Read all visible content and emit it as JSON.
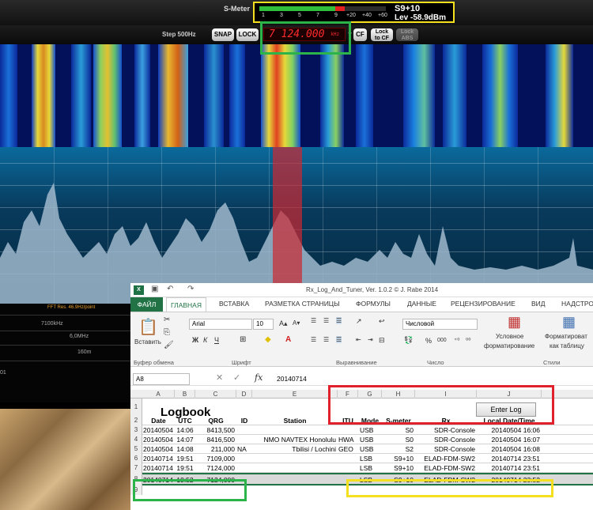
{
  "smeter": {
    "label": "S-Meter",
    "scale": [
      "1",
      "3",
      "5",
      "7",
      "9",
      "+20",
      "+40",
      "+60"
    ],
    "reading": "S9+10",
    "level": "Lev -58.9dBm"
  },
  "sdr_controls": {
    "step": "Step 500Hz",
    "snap": "SNAP",
    "lock": "LOCK",
    "frequency": "7 124.000",
    "freq_unit": "kHz",
    "cf": "CF",
    "lock_to_cf_1": "Lock",
    "lock_to_cf_2": "to CF",
    "lock_abs_1": "Lock",
    "lock_abs_2": "ABS",
    "plus_minus": "+"
  },
  "lower_panel": {
    "fft_res": "FFT Res. 46.9Hz/point",
    "freq1": "7100kHz",
    "freq2": "6,0MHz",
    "len": "160m",
    "side": "01"
  },
  "excel": {
    "title": "Rx_Log_And_Tuner, Ver. 1.0.2 © J. Rabe 2014",
    "file_tab": "ФАЙЛ",
    "tabs": [
      "ГЛАВНАЯ",
      "ВСТАВКА",
      "РАЗМЕТКА СТРАНИЦЫ",
      "ФОРМУЛЫ",
      "ДАННЫЕ",
      "РЕЦЕНЗИРОВАНИЕ",
      "ВИД",
      "НАДСТРОЙ"
    ],
    "ribbon": {
      "paste": "Вставить",
      "font_name": "Arial",
      "font_size": "10",
      "bold": "Ж",
      "italic": "К",
      "underline": "Ч",
      "number_format": "Числовой",
      "percent": "%",
      "thousands": "000",
      "conditional_1": "Условное",
      "conditional_2": "форматирование",
      "table_1": "Форматироват",
      "table_2": "как таблицу",
      "groups": [
        "Буфер обмена",
        "Шрифт",
        "Выравнивание",
        "Число",
        "Стили"
      ]
    },
    "name_box": "A8",
    "formula": "20140714",
    "columns": [
      "A",
      "B",
      "C",
      "D",
      "E",
      "F",
      "G",
      "H",
      "I",
      "J"
    ],
    "row_numbers": [
      "1",
      "2",
      "3",
      "4",
      "5",
      "6",
      "7",
      "8",
      "9"
    ],
    "sheet_title": "Logbook",
    "enter_log": "Enter Log",
    "headers": [
      "Date",
      "UTC",
      "QRG",
      "ID",
      "Station",
      "ITU",
      "Mode",
      "S-meter",
      "Rx",
      "Local Date/Time"
    ],
    "rows": [
      [
        "20140504",
        "14:06",
        "8413,500",
        "",
        "",
        "",
        "USB",
        "S0",
        "SDR-Console",
        "20140504 16:06"
      ],
      [
        "20140504",
        "14:07",
        "8416,500",
        "",
        "NMO NAVTEX Honolulu",
        "HWA",
        "USB",
        "S0",
        "SDR-Console",
        "20140504 16:07"
      ],
      [
        "20140504",
        "14:08",
        "211,000",
        "NA",
        "Tbilisi / Lochini",
        "GEO",
        "USB",
        "S2",
        "SDR-Console",
        "20140504 16:08"
      ],
      [
        "20140714",
        "19:51",
        "7109,000",
        "",
        "",
        "",
        "LSB",
        "S9+10",
        "ELAD-FDM-SW2",
        "20140714 23:51"
      ],
      [
        "20140714",
        "19:51",
        "7124,000",
        "",
        "",
        "",
        "LSB",
        "S9+10",
        "ELAD-FDM-SW2",
        "20140714 23:51"
      ],
      [
        "20140714",
        "19:52",
        "7124,000",
        "",
        "",
        "",
        "LSB",
        "S9+10",
        "ELAD-FDM-SW2",
        "20140714 23:52"
      ]
    ]
  },
  "colors": {
    "highlight_yellow": "#f5e020",
    "highlight_green": "#2cb34a",
    "highlight_red": "#e0202a",
    "excel_green": "#217346"
  }
}
